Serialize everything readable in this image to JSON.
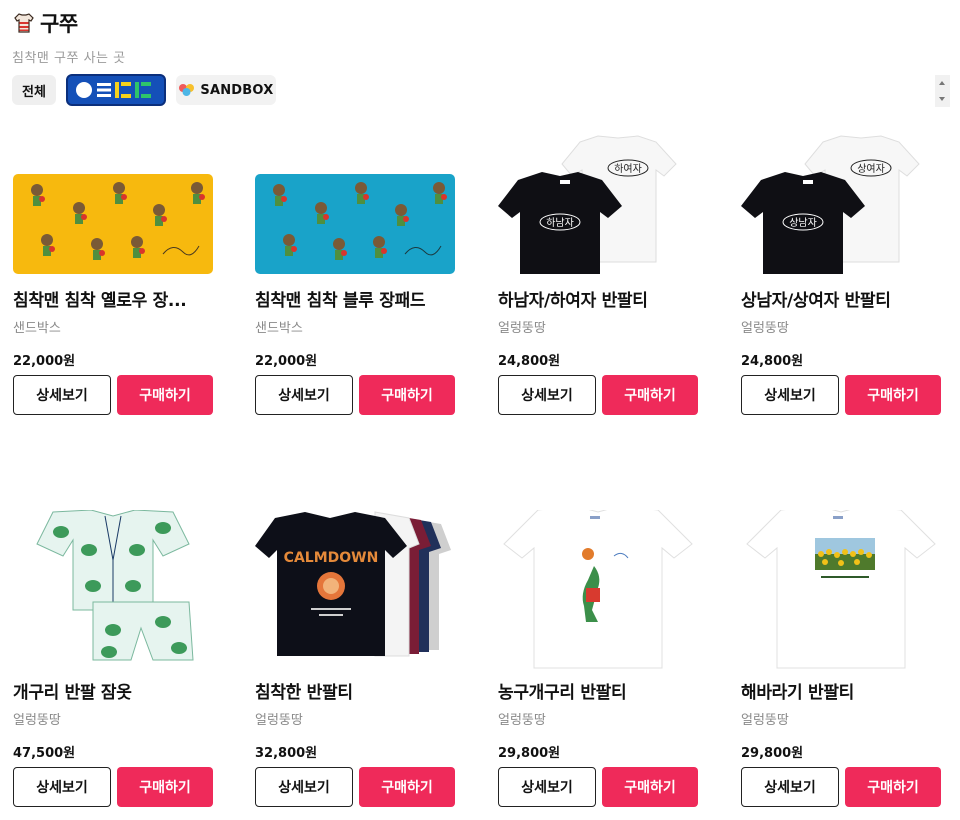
{
  "header": {
    "title": "구쭈",
    "subtitle": "침착맨 구쭈 사는 곳",
    "icon": "tshirt-icon"
  },
  "filters": {
    "all_label": "전체",
    "logo_a": "ooo-logo",
    "logo_b_label": "SANDBOX"
  },
  "buttons": {
    "detail": "상세보기",
    "buy": "구매하기"
  },
  "colors": {
    "accent": "#ef2a5a",
    "yellow_pad": "#f7b90e",
    "blue_pad": "#19a3c9",
    "logo_blue": "#1450b8"
  },
  "products": [
    {
      "name": "침착맨 침착 옐로우 장...",
      "brand": "샌드박스",
      "price": "22,000원"
    },
    {
      "name": "침착맨 침착 블루 장패드",
      "brand": "샌드박스",
      "price": "22,000원"
    },
    {
      "name": "하남자/하여자 반팔티",
      "brand": "얼렁뚱땅",
      "price": "24,800원",
      "shirt_text_front": "하남자",
      "shirt_text_back": "하여자"
    },
    {
      "name": "상남자/상여자 반팔티",
      "brand": "얼렁뚱땅",
      "price": "24,800원",
      "shirt_text_front": "상남자",
      "shirt_text_back": "상여자"
    },
    {
      "name": "개구리 반팔 잠옷",
      "brand": "얼렁뚱땅",
      "price": "47,500원"
    },
    {
      "name": "침착한 반팔티",
      "brand": "얼렁뚱땅",
      "price": "32,800원",
      "shirt_text": "CALMDOWN"
    },
    {
      "name": "농구개구리 반팔티",
      "brand": "얼렁뚱땅",
      "price": "29,800원"
    },
    {
      "name": "해바라기 반팔티",
      "brand": "얼렁뚱땅",
      "price": "29,800원"
    }
  ]
}
